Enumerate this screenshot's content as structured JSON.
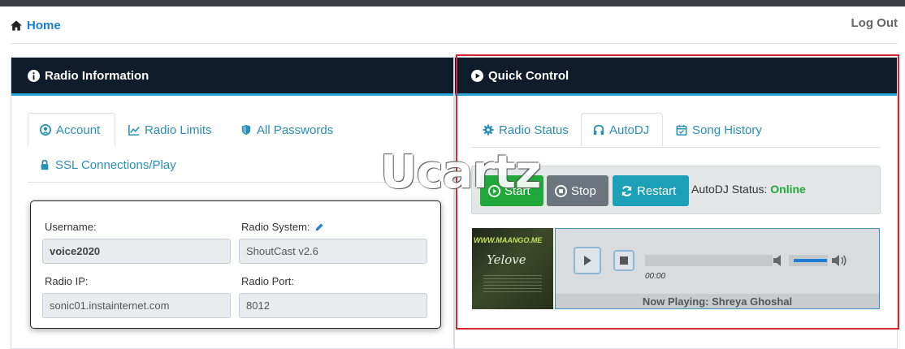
{
  "topnav": {
    "home": "Home",
    "logout": "Log Out"
  },
  "left_panel": {
    "title": "Radio Information",
    "tabs": [
      "Account",
      "Radio Limits",
      "All Passwords",
      "SSL Connections/Play"
    ],
    "active_tab": "Account",
    "fields": {
      "username_label": "Username:",
      "username_value": "voice2020",
      "system_label": "Radio System:",
      "system_value": "ShoutCast v2.6",
      "ip_label": "Radio IP:",
      "ip_value": "sonic01.instainternet.com",
      "port_label": "Radio Port:",
      "port_value": "8012"
    }
  },
  "right_panel": {
    "title": "Quick Control",
    "tabs": [
      "Radio Status",
      "AutoDJ",
      "Song History"
    ],
    "active_tab": "AutoDJ",
    "buttons": {
      "start": "Start",
      "stop": "Stop",
      "restart": "Restart"
    },
    "status_label": "AutoDJ Status:",
    "status_value": "Online",
    "player": {
      "time": "00:00",
      "now_playing": "Now Playing: Shreya Ghoshal",
      "volume_fraction": 0.85
    },
    "cover": {
      "site": "WWW.MAANGO.ME",
      "logo": "Yelove"
    }
  },
  "watermark": "Ucartz",
  "colors": {
    "header_bg": "#0f1c2b",
    "accent": "#2aa4d4",
    "start": "#21a83a",
    "stop": "#6c757d",
    "restart": "#1ba0b8",
    "highlight_box": "#d7262e"
  }
}
